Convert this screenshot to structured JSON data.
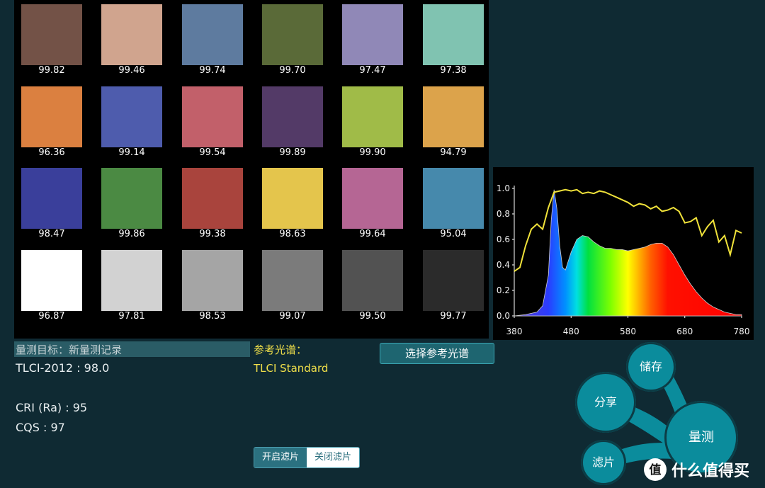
{
  "swatches": [
    {
      "color": "#735247",
      "value": "99.82"
    },
    {
      "color": "#d0a48e",
      "value": "99.46"
    },
    {
      "color": "#5e7b9f",
      "value": "99.74"
    },
    {
      "color": "#5a6a38",
      "value": "99.70"
    },
    {
      "color": "#9088b7",
      "value": "97.47"
    },
    {
      "color": "#80c3b1",
      "value": "97.38"
    },
    {
      "color": "#db8040",
      "value": "96.36"
    },
    {
      "color": "#4e5cad",
      "value": "99.14"
    },
    {
      "color": "#c2606a",
      "value": "99.54"
    },
    {
      "color": "#533a67",
      "value": "99.89"
    },
    {
      "color": "#a0bb48",
      "value": "99.90"
    },
    {
      "color": "#dca34b",
      "value": "94.79"
    },
    {
      "color": "#3a3f9b",
      "value": "98.47"
    },
    {
      "color": "#4b8a43",
      "value": "99.86"
    },
    {
      "color": "#a9443d",
      "value": "99.38"
    },
    {
      "color": "#e4c54c",
      "value": "98.63"
    },
    {
      "color": "#b56694",
      "value": "99.64"
    },
    {
      "color": "#4689ac",
      "value": "95.04"
    },
    {
      "color": "#ffffff",
      "value": "96.87"
    },
    {
      "color": "#d2d2d2",
      "value": "97.81"
    },
    {
      "color": "#a5a5a5",
      "value": "98.53"
    },
    {
      "color": "#7b7b7b",
      "value": "99.07"
    },
    {
      "color": "#525252",
      "value": "99.50"
    },
    {
      "color": "#2b2b2b",
      "value": "99.77"
    }
  ],
  "info": {
    "target_label": "量测目标：新量测记录",
    "tlci": "TLCI-2012 : 98.0",
    "cri": "CRI (Ra) : 95",
    "cqs": "CQS : 97",
    "ref_label": "参考光谱：",
    "ref_value": "TLCI Standard",
    "ref_button": "选择参考光谱"
  },
  "filter": {
    "on_label": "开启滤片",
    "off_label": "关闭滤片",
    "selected": "on"
  },
  "menu": {
    "store": "储存",
    "share": "分享",
    "measure": "量测",
    "filter": "滤片"
  },
  "watermark": {
    "text": "什么值得买"
  },
  "chart_data": {
    "type": "area",
    "xlim": [
      380,
      780
    ],
    "ylim": [
      0,
      1.0
    ],
    "xticks": [
      "380",
      "480",
      "580",
      "680",
      "780"
    ],
    "yticks": [
      "0.0",
      "0.2",
      "0.4",
      "0.6",
      "0.8",
      "1.0"
    ],
    "series": [
      {
        "style": "spectrum-fill",
        "x": [
          380,
          400,
          420,
          430,
          440,
          445,
          450,
          455,
          460,
          465,
          470,
          480,
          490,
          500,
          510,
          520,
          530,
          540,
          550,
          560,
          570,
          580,
          590,
          600,
          610,
          620,
          630,
          640,
          650,
          660,
          670,
          680,
          690,
          700,
          710,
          720,
          730,
          740,
          750,
          760,
          770,
          780
        ],
        "values": [
          0.0,
          0.01,
          0.03,
          0.08,
          0.32,
          0.75,
          0.99,
          0.84,
          0.55,
          0.38,
          0.36,
          0.5,
          0.6,
          0.63,
          0.62,
          0.58,
          0.55,
          0.53,
          0.53,
          0.52,
          0.52,
          0.51,
          0.52,
          0.53,
          0.54,
          0.56,
          0.57,
          0.57,
          0.54,
          0.48,
          0.4,
          0.32,
          0.25,
          0.19,
          0.14,
          0.1,
          0.07,
          0.05,
          0.03,
          0.02,
          0.01,
          0.01
        ]
      },
      {
        "style": "yellow-line",
        "color": "#f0e23a",
        "x": [
          380,
          390,
          400,
          410,
          420,
          430,
          440,
          450,
          460,
          470,
          480,
          490,
          500,
          510,
          520,
          530,
          540,
          550,
          560,
          570,
          580,
          590,
          600,
          610,
          620,
          630,
          640,
          650,
          660,
          670,
          680,
          690,
          700,
          710,
          720,
          730,
          740,
          750,
          760,
          770,
          780
        ],
        "values": [
          0.35,
          0.38,
          0.55,
          0.68,
          0.72,
          0.68,
          0.85,
          0.97,
          0.98,
          0.99,
          0.98,
          0.99,
          0.96,
          0.97,
          0.96,
          0.98,
          0.97,
          0.95,
          0.93,
          0.91,
          0.89,
          0.86,
          0.88,
          0.87,
          0.84,
          0.86,
          0.82,
          0.83,
          0.85,
          0.82,
          0.73,
          0.74,
          0.77,
          0.63,
          0.7,
          0.75,
          0.58,
          0.63,
          0.48,
          0.67,
          0.65
        ]
      }
    ]
  }
}
